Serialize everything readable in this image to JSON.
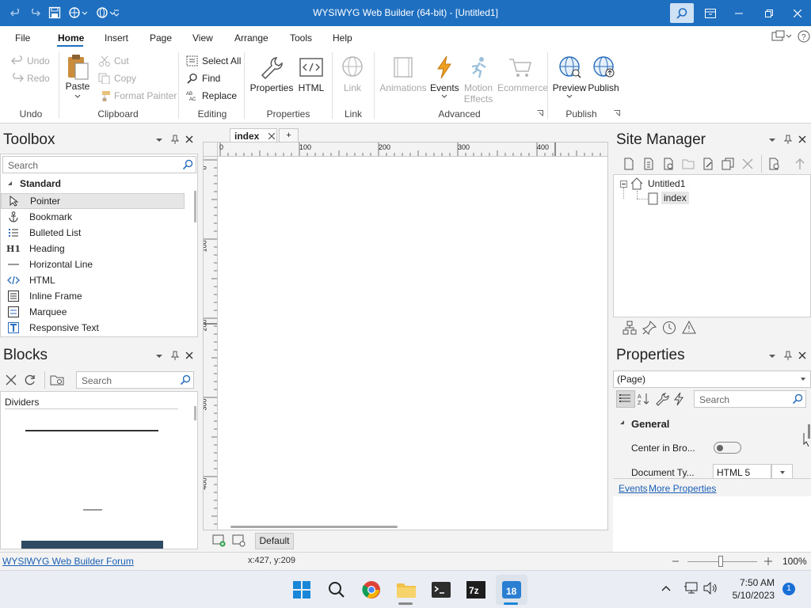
{
  "titlebar": {
    "title": "WYSIWYG Web Builder (64-bit) - [Untitled1]"
  },
  "menu": [
    "File",
    "Home",
    "Insert",
    "Page",
    "View",
    "Arrange",
    "Tools",
    "Help"
  ],
  "ribbon": {
    "undo": "Undo",
    "redo": "Redo",
    "group_undo": "Undo",
    "paste": "Paste",
    "cut": "Cut",
    "copy": "Copy",
    "format_painter": "Format Painter",
    "group_clipboard": "Clipboard",
    "select_all": "Select All",
    "find": "Find",
    "replace": "Replace",
    "group_editing": "Editing",
    "properties": "Properties",
    "html": "HTML",
    "group_properties": "Properties",
    "link": "Link",
    "group_link": "Link",
    "animations": "Animations",
    "events": "Events",
    "motion_effects_1": "Motion",
    "motion_effects_2": "Effects",
    "ecommerce": "Ecommerce",
    "group_advanced": "Advanced",
    "preview": "Preview",
    "publish": "Publish",
    "group_publish": "Publish"
  },
  "toolbox": {
    "title": "Toolbox",
    "search_placeholder": "Search",
    "category": "Standard",
    "items": [
      "Pointer",
      "Bookmark",
      "Bulleted List",
      "Heading",
      "Horizontal Line",
      "HTML",
      "Inline Frame",
      "Marquee",
      "Responsive Text"
    ]
  },
  "blocks": {
    "title": "Blocks",
    "search_placeholder": "Search",
    "category": "Dividers"
  },
  "editor": {
    "tab": "index",
    "add_tab": "+",
    "ruler_h": [
      "0",
      "100",
      "200",
      "300",
      "400"
    ],
    "ruler_v": [
      "0",
      "100",
      "200",
      "300",
      "400"
    ],
    "layout_button": "Default"
  },
  "site_manager": {
    "title": "Site Manager",
    "root": "Untitled1",
    "page": "index"
  },
  "properties": {
    "title": "Properties",
    "selector": "(Page)",
    "search_placeholder": "Search",
    "section": "General",
    "rows": [
      {
        "label": "Center in Bro...",
        "value": ""
      },
      {
        "label": "Document Ty...",
        "value": "HTML 5"
      }
    ],
    "link_events": "Events",
    "link_more": "More Properties"
  },
  "statusbar": {
    "forum_link": "WYSIWYG Web Builder Forum",
    "coords": "x:427, y:209",
    "zoom": "100%",
    "zoom_level": 1.0
  },
  "taskbar": {
    "time": "7:50 AM",
    "date": "5/10/2023",
    "notification_count": "1"
  },
  "colors": {
    "titlebar": "#1e6fc0",
    "accent": "#1e6fc0"
  }
}
